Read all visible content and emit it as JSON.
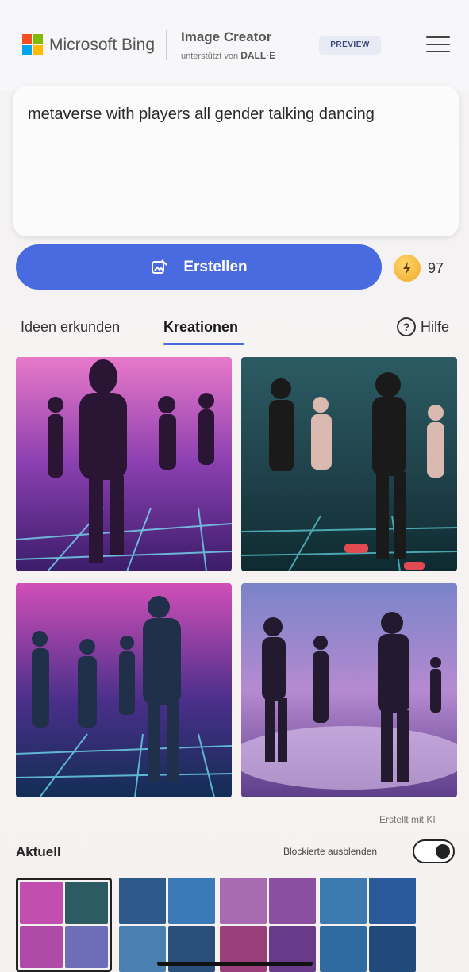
{
  "header": {
    "brand": "Microsoft Bing",
    "title": "Image Creator",
    "subtitle_prefix": "unterstützt von",
    "subtitle_model": "DALL·E",
    "badge": "PREVIEW",
    "logo_colors": [
      "#f25022",
      "#7fba00",
      "#00a4ef",
      "#ffb900"
    ],
    "menu_icon": "hamburger-menu-icon"
  },
  "prompt": {
    "value": "metaverse with players all gender talking dancing"
  },
  "actions": {
    "create_label": "Erstellen",
    "create_icon": "image-create-icon",
    "boost_icon": "lightning-boost-icon",
    "boost_count": "97",
    "accent_color": "#4a6ae0"
  },
  "tabs": {
    "items": [
      {
        "label": "Ideen erkunden",
        "active": false
      },
      {
        "label": "Kreationen",
        "active": true
      }
    ],
    "help_label": "Hilfe",
    "help_icon": "question-circle-icon"
  },
  "results": {
    "images": [
      {
        "alt": "generated-image-1"
      },
      {
        "alt": "generated-image-2"
      },
      {
        "alt": "generated-image-3"
      },
      {
        "alt": "generated-image-4"
      }
    ],
    "ai_note": "Erstellt mit KI"
  },
  "recent": {
    "title": "Aktuell",
    "toggle_label": "Blockierte ausblenden",
    "toggle_on": true,
    "thumbnail_sets": 4
  }
}
